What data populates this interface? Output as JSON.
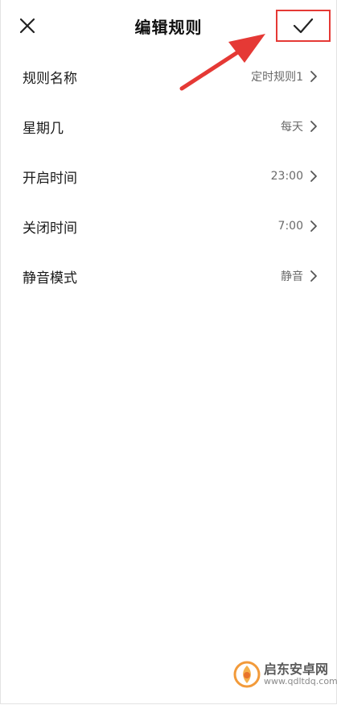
{
  "header": {
    "title": "编辑规则",
    "close_icon": "close-icon",
    "confirm_icon": "checkmark-icon"
  },
  "rows": [
    {
      "label": "规则名称",
      "value": "定时规则1"
    },
    {
      "label": "星期几",
      "value": "每天"
    },
    {
      "label": "开启时间",
      "value": "23:00"
    },
    {
      "label": "关闭时间",
      "value": "7:00"
    },
    {
      "label": "静音模式",
      "value": "静音"
    }
  ],
  "annotation": {
    "color": "#e53935"
  },
  "watermark": {
    "name": "启东安卓网",
    "url": "www.qdltdq.com"
  }
}
